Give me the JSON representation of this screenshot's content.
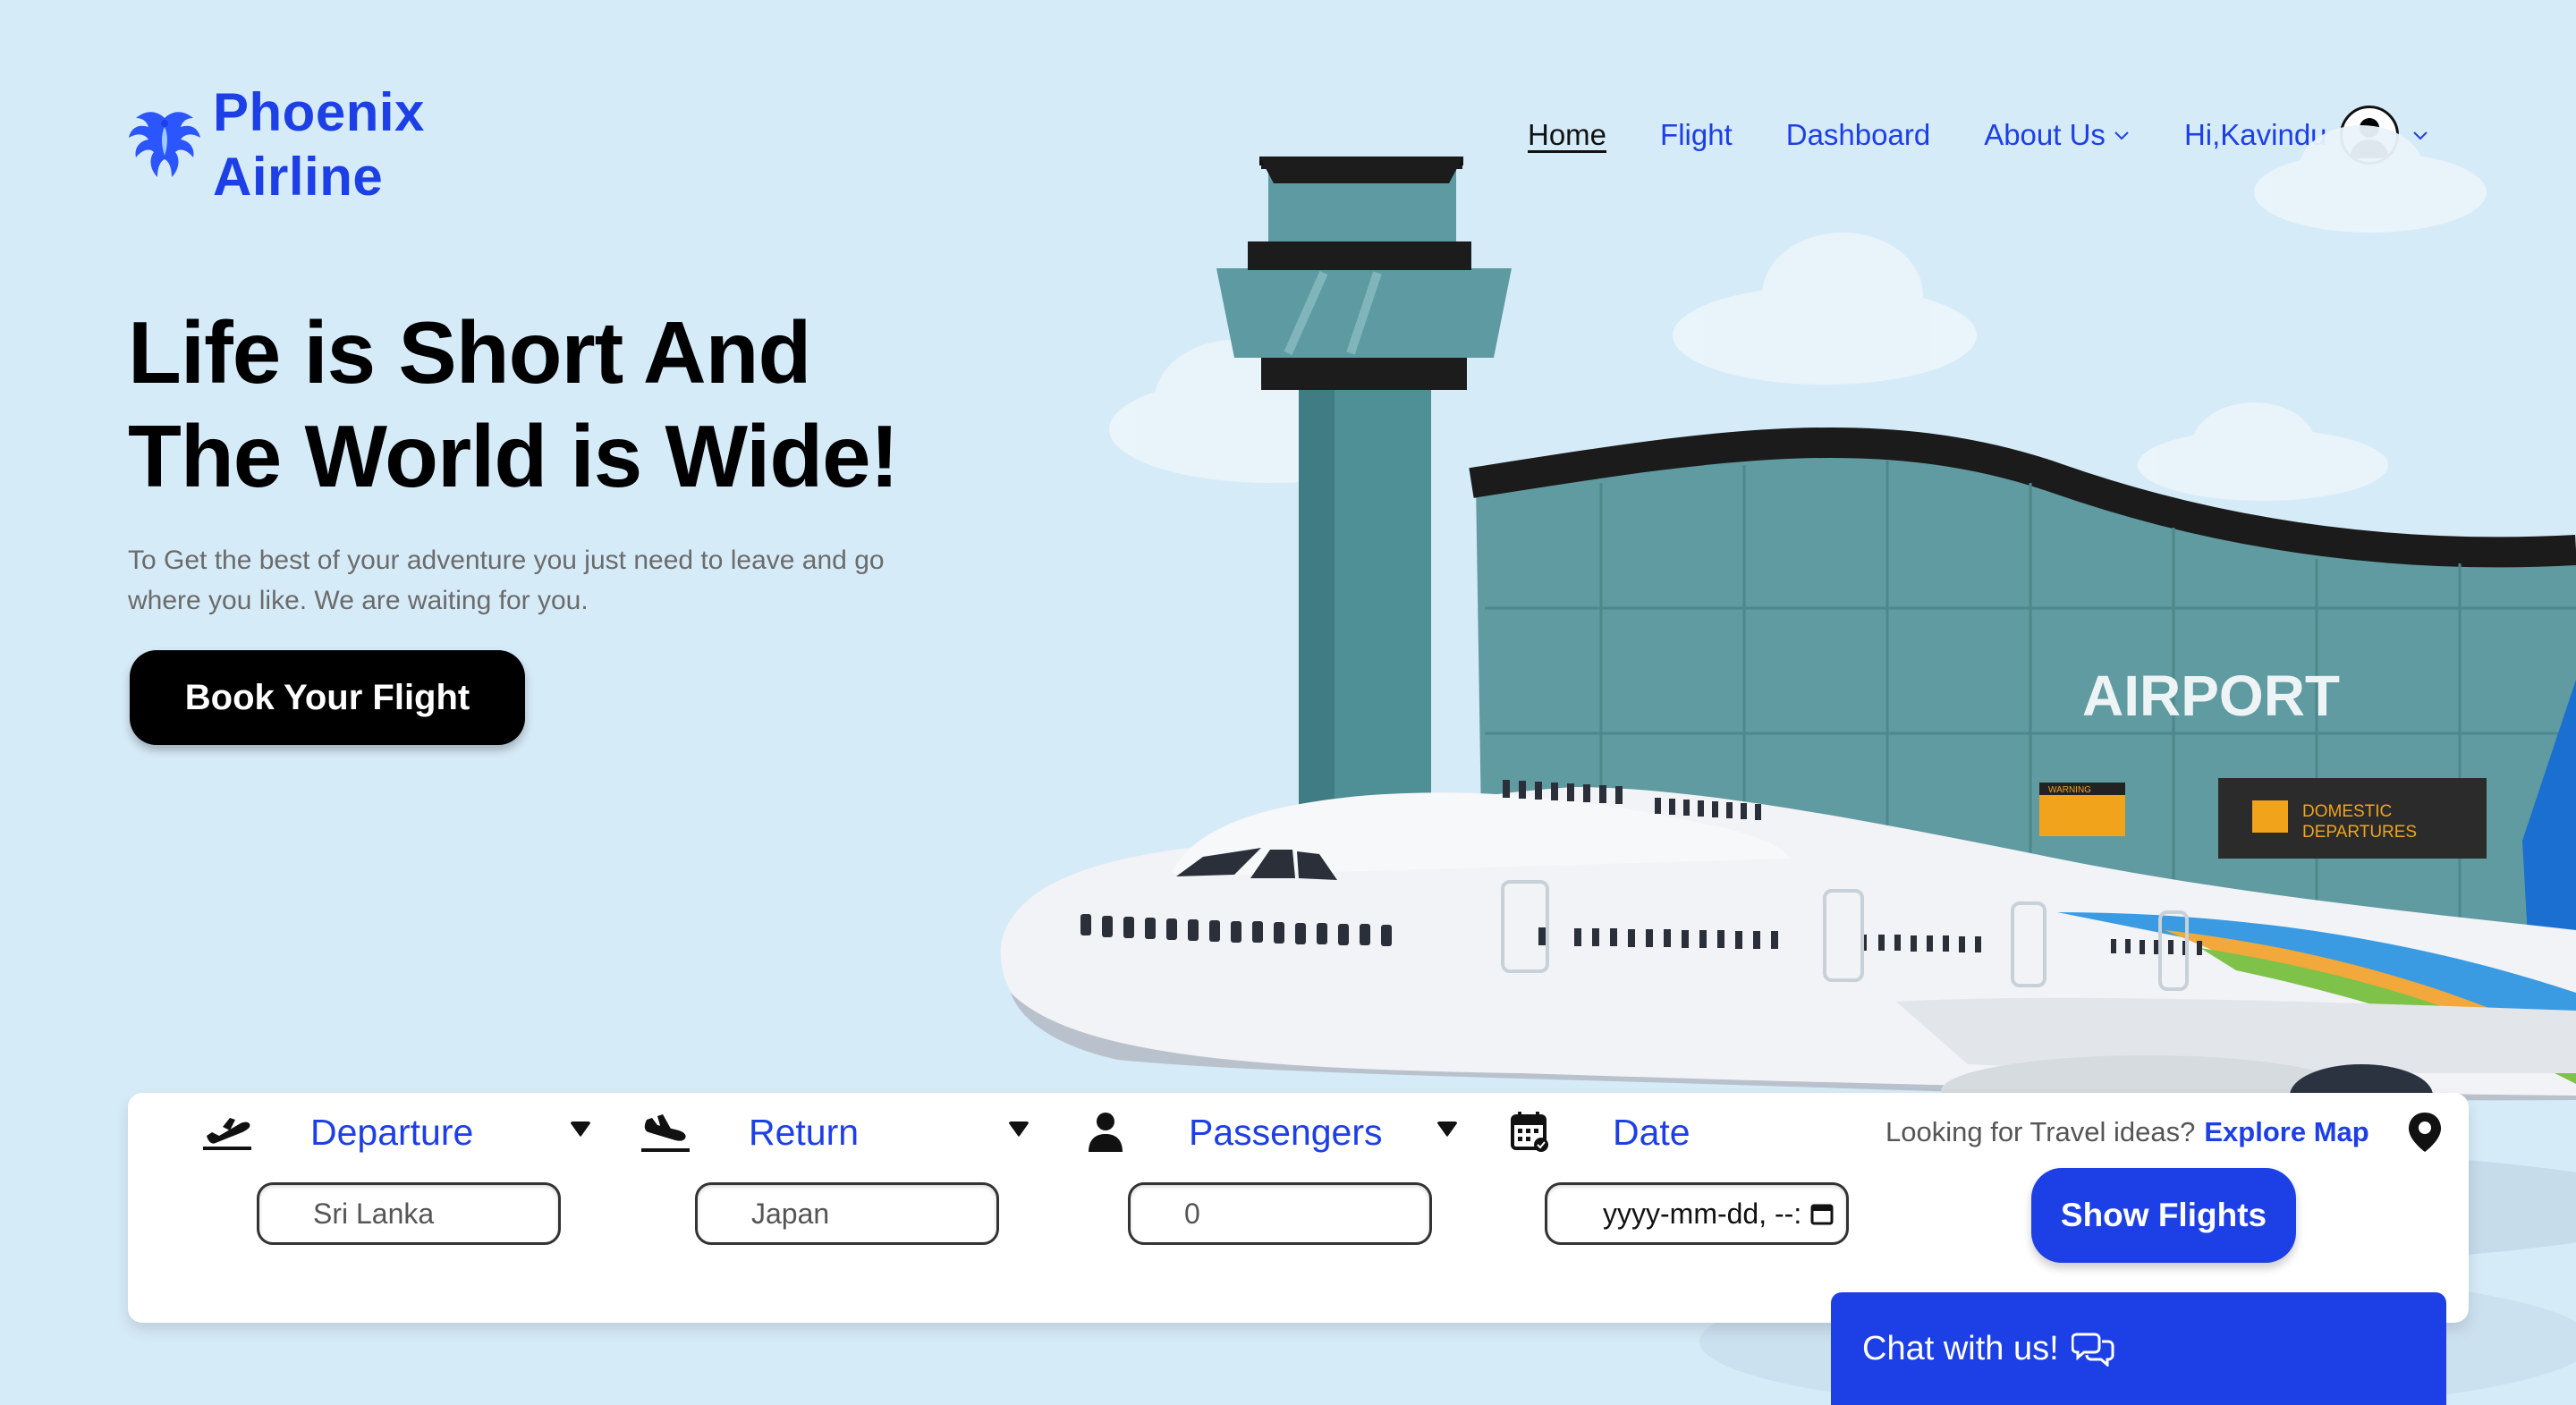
{
  "brand": {
    "line1": "Phoenix",
    "line2": "Airline"
  },
  "nav": {
    "items": [
      {
        "label": "Home",
        "active": true
      },
      {
        "label": "Flight"
      },
      {
        "label": "Dashboard"
      },
      {
        "label": "About Us"
      }
    ],
    "greeting": "Hi,Kavindu"
  },
  "hero": {
    "title_line1": "Life is Short And",
    "title_line2": "The World is Wide!",
    "subtitle": "To Get the best of your adventure you just need to leave and go where you like. We are waiting for you.",
    "cta": "Book Your Flight"
  },
  "scene": {
    "building_sign": "AIRPORT",
    "warning_sign": "WARNING",
    "departures_line1": "DOMESTIC",
    "departures_line2": "DEPARTURES"
  },
  "search": {
    "departure": {
      "label": "Departure",
      "value": "Sri Lanka"
    },
    "return": {
      "label": "Return",
      "value": "Japan"
    },
    "passengers": {
      "label": "Passengers",
      "value": "0"
    },
    "date": {
      "label": "Date",
      "value": "yyyy-mm-dd, --:"
    },
    "explore_prompt": "Looking for Travel ideas?",
    "explore_link": "Explore Map",
    "submit": "Show Flights"
  },
  "chat": {
    "label": "Chat with us!"
  },
  "colors": {
    "accent": "#1d3fe6",
    "background": "#d6ebf8"
  }
}
